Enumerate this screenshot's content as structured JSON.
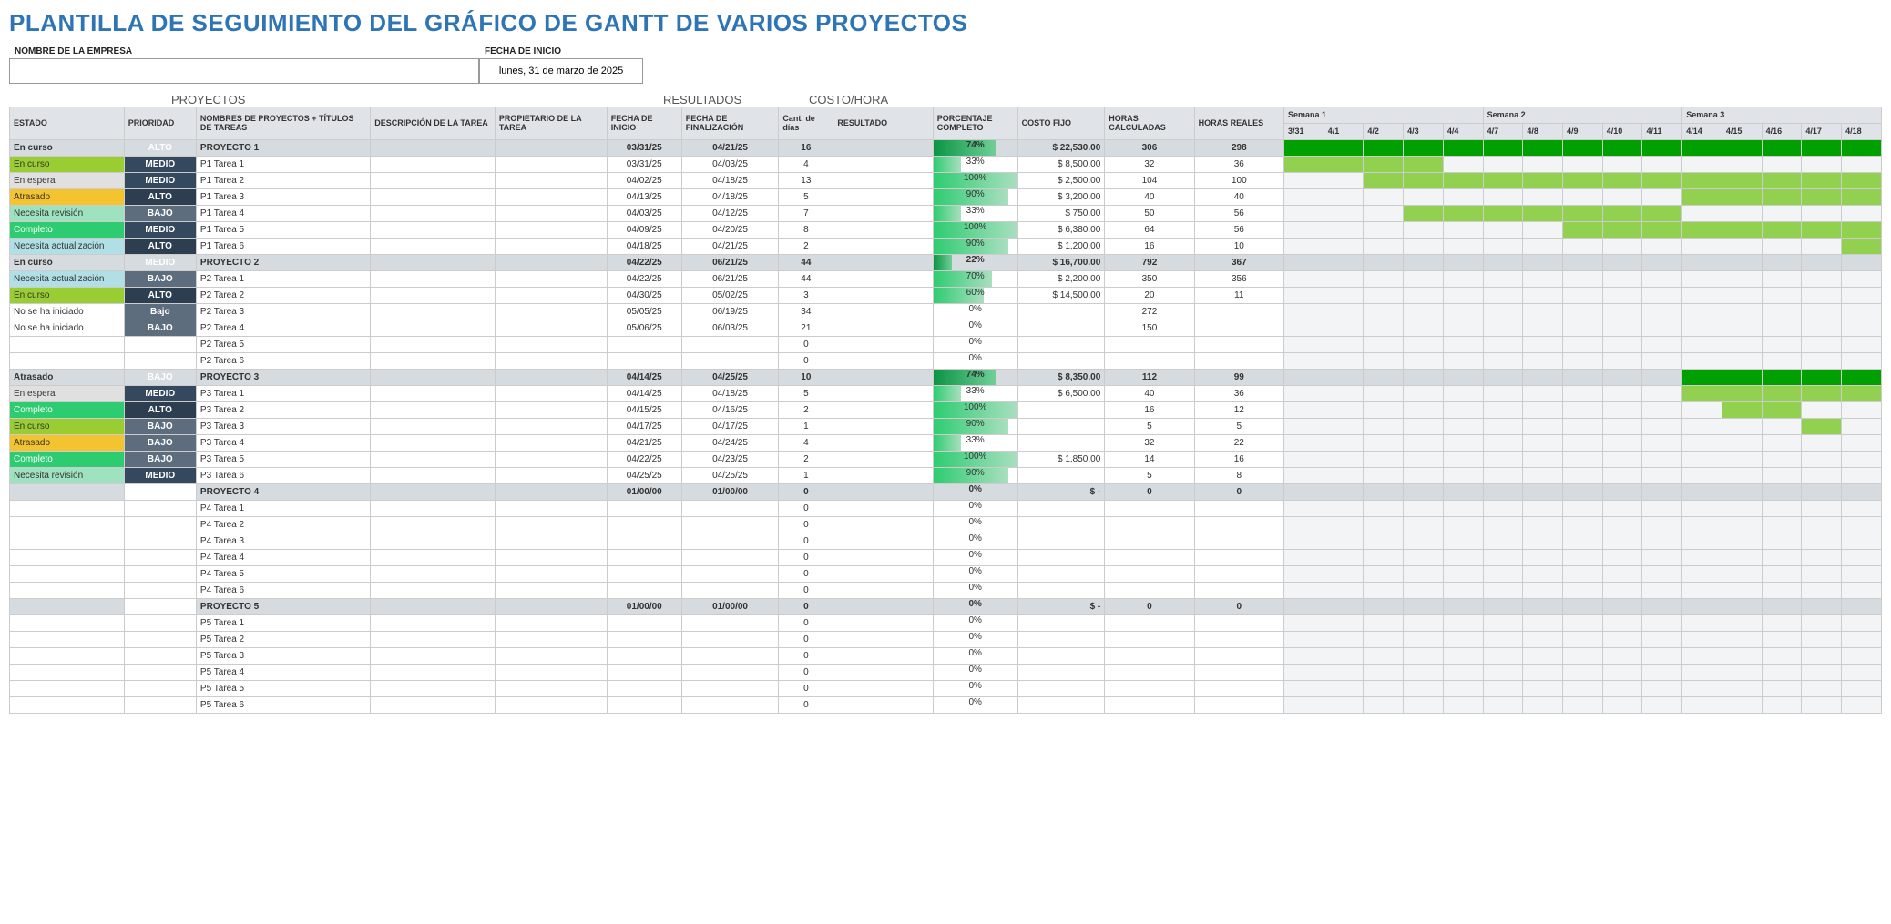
{
  "title": "PLANTILLA DE SEGUIMIENTO DEL GRÁFICO DE GANTT DE VARIOS PROYECTOS",
  "meta": {
    "company_label": "NOMBRE DE LA EMPRESA",
    "company_value": "",
    "date_label": "FECHA DE INICIO",
    "date_value": "lunes, 31 de marzo de 2025"
  },
  "sections": {
    "projects": "PROYECTOS",
    "results": "RESULTADOS",
    "cost": "COSTO/HORA"
  },
  "headers": {
    "estado": "ESTADO",
    "prioridad": "PRIORIDAD",
    "nombre": "NOMBRES DE PROYECTOS + TÍTULOS DE TAREAS",
    "descripcion": "DESCRIPCIÓN DE LA TAREA",
    "propietario": "PROPIETARIO DE LA TAREA",
    "inicio": "FECHA DE INICIO",
    "fin": "FECHA DE FINALIZACIÓN",
    "dias": "Cant. de días",
    "resultado": "RESULTADO",
    "pct": "PORCENTAJE COMPLETO",
    "costo": "COSTO FIJO",
    "hcalc": "HORAS CALCULADAS",
    "hreal": "HORAS REALES"
  },
  "weeks": [
    {
      "label": "Semana 1",
      "days": [
        "3/31",
        "4/1",
        "4/2",
        "4/3",
        "4/4"
      ]
    },
    {
      "label": "Semana 2",
      "days": [
        "4/7",
        "4/8",
        "4/9",
        "4/10",
        "4/11"
      ]
    },
    {
      "label": "Semana 3",
      "days": [
        "4/14",
        "4/15",
        "4/16",
        "4/17",
        "4/18"
      ]
    }
  ],
  "status_map": {
    "En curso": "st-encurso",
    "En espera": "st-enespera",
    "Atrasado": "st-atrasado",
    "Necesita revisión": "st-revision",
    "Completo": "st-completo",
    "Necesita actualización": "st-actualizacion",
    "No se ha iniciado": "st-noiniciado",
    "": ""
  },
  "prio_map": {
    "ALTO": "pr-alto",
    "MEDIO": "pr-medio",
    "BAJO": "pr-bajo",
    "Bajo": "pr-bajo",
    "": ""
  },
  "rows": [
    {
      "type": "project",
      "estado": "En curso",
      "prio": "ALTO",
      "nombre": "PROYECTO 1",
      "inicio": "03/31/25",
      "fin": "04/21/25",
      "dias": "16",
      "pct": 74,
      "costo": "$   22,530.00",
      "hcalc": "306",
      "hreal": "298",
      "bar": [
        0,
        15,
        "dark"
      ]
    },
    {
      "estado": "En curso",
      "prio": "MEDIO",
      "nombre": "P1 Tarea 1",
      "inicio": "03/31/25",
      "fin": "04/03/25",
      "dias": "4",
      "pct": 33,
      "costo": "$    8,500.00",
      "hcalc": "32",
      "hreal": "36",
      "bar": [
        0,
        4,
        "light"
      ]
    },
    {
      "estado": "En espera",
      "prio": "MEDIO",
      "nombre": "P1 Tarea 2",
      "inicio": "04/02/25",
      "fin": "04/18/25",
      "dias": "13",
      "pct": 100,
      "costo": "$    2,500.00",
      "hcalc": "104",
      "hreal": "100",
      "bar": [
        2,
        15,
        "light"
      ]
    },
    {
      "estado": "Atrasado",
      "prio": "ALTO",
      "nombre": "P1 Tarea 3",
      "inicio": "04/13/25",
      "fin": "04/18/25",
      "dias": "5",
      "pct": 90,
      "costo": "$    3,200.00",
      "hcalc": "40",
      "hreal": "40",
      "bar": [
        10,
        15,
        "light"
      ]
    },
    {
      "estado": "Necesita revisión",
      "prio": "BAJO",
      "nombre": "P1 Tarea 4",
      "inicio": "04/03/25",
      "fin": "04/12/25",
      "dias": "7",
      "pct": 33,
      "costo": "$      750.00",
      "hcalc": "50",
      "hreal": "56",
      "bar": [
        3,
        10,
        "light"
      ]
    },
    {
      "estado": "Completo",
      "prio": "MEDIO",
      "nombre": "P1 Tarea 5",
      "inicio": "04/09/25",
      "fin": "04/20/25",
      "dias": "8",
      "pct": 100,
      "costo": "$    6,380.00",
      "hcalc": "64",
      "hreal": "56",
      "bar": [
        7,
        15,
        "light"
      ]
    },
    {
      "estado": "Necesita actualización",
      "prio": "ALTO",
      "nombre": "P1 Tarea 6",
      "inicio": "04/18/25",
      "fin": "04/21/25",
      "dias": "2",
      "pct": 90,
      "costo": "$    1,200.00",
      "hcalc": "16",
      "hreal": "10",
      "bar": [
        14,
        15,
        "light"
      ]
    },
    {
      "type": "project",
      "estado": "En curso",
      "prio": "MEDIO",
      "nombre": "PROYECTO 2",
      "inicio": "04/22/25",
      "fin": "06/21/25",
      "dias": "44",
      "pct": 22,
      "costo": "$   16,700.00",
      "hcalc": "792",
      "hreal": "367"
    },
    {
      "estado": "Necesita actualización",
      "prio": "BAJO",
      "nombre": "P2 Tarea 1",
      "inicio": "04/22/25",
      "fin": "06/21/25",
      "dias": "44",
      "pct": 70,
      "costo": "$    2,200.00",
      "hcalc": "350",
      "hreal": "356"
    },
    {
      "estado": "En curso",
      "prio": "ALTO",
      "nombre": "P2 Tarea 2",
      "inicio": "04/30/25",
      "fin": "05/02/25",
      "dias": "3",
      "pct": 60,
      "costo": "$   14,500.00",
      "hcalc": "20",
      "hreal": "11"
    },
    {
      "estado": "No se ha iniciado",
      "prio": "Bajo",
      "nombre": "P2 Tarea 3",
      "inicio": "05/05/25",
      "fin": "06/19/25",
      "dias": "34",
      "pct": 0,
      "costo": "",
      "hcalc": "272",
      "hreal": ""
    },
    {
      "estado": "No se ha iniciado",
      "prio": "BAJO",
      "nombre": "P2 Tarea 4",
      "inicio": "05/06/25",
      "fin": "06/03/25",
      "dias": "21",
      "pct": 0,
      "costo": "",
      "hcalc": "150",
      "hreal": ""
    },
    {
      "estado": "",
      "prio": "",
      "nombre": "P2 Tarea 5",
      "inicio": "",
      "fin": "",
      "dias": "0",
      "pct": 0,
      "costo": "",
      "hcalc": "",
      "hreal": ""
    },
    {
      "estado": "",
      "prio": "",
      "nombre": "P2 Tarea 6",
      "inicio": "",
      "fin": "",
      "dias": "0",
      "pct": 0,
      "costo": "",
      "hcalc": "",
      "hreal": ""
    },
    {
      "type": "project",
      "estado": "Atrasado",
      "prio": "BAJO",
      "nombre": "PROYECTO 3",
      "inicio": "04/14/25",
      "fin": "04/25/25",
      "dias": "10",
      "pct": 74,
      "costo": "$    8,350.00",
      "hcalc": "112",
      "hreal": "99",
      "bar": [
        10,
        15,
        "dark"
      ]
    },
    {
      "estado": "En espera",
      "prio": "MEDIO",
      "nombre": "P3 Tarea 1",
      "inicio": "04/14/25",
      "fin": "04/18/25",
      "dias": "5",
      "pct": 33,
      "costo": "$    6,500.00",
      "hcalc": "40",
      "hreal": "36",
      "bar": [
        10,
        15,
        "light"
      ]
    },
    {
      "estado": "Completo",
      "prio": "ALTO",
      "nombre": "P3 Tarea 2",
      "inicio": "04/15/25",
      "fin": "04/16/25",
      "dias": "2",
      "pct": 100,
      "costo": "",
      "hcalc": "16",
      "hreal": "12",
      "bar": [
        11,
        13,
        "light"
      ]
    },
    {
      "estado": "En curso",
      "prio": "BAJO",
      "nombre": "P3 Tarea 3",
      "inicio": "04/17/25",
      "fin": "04/17/25",
      "dias": "1",
      "pct": 90,
      "costo": "",
      "hcalc": "5",
      "hreal": "5",
      "bar": [
        13,
        14,
        "light"
      ]
    },
    {
      "estado": "Atrasado",
      "prio": "BAJO",
      "nombre": "P3 Tarea 4",
      "inicio": "04/21/25",
      "fin": "04/24/25",
      "dias": "4",
      "pct": 33,
      "costo": "",
      "hcalc": "32",
      "hreal": "22"
    },
    {
      "estado": "Completo",
      "prio": "BAJO",
      "nombre": "P3 Tarea 5",
      "inicio": "04/22/25",
      "fin": "04/23/25",
      "dias": "2",
      "pct": 100,
      "costo": "$    1,850.00",
      "hcalc": "14",
      "hreal": "16"
    },
    {
      "estado": "Necesita revisión",
      "prio": "MEDIO",
      "nombre": "P3 Tarea 6",
      "inicio": "04/25/25",
      "fin": "04/25/25",
      "dias": "1",
      "pct": 90,
      "costo": "",
      "hcalc": "5",
      "hreal": "8"
    },
    {
      "type": "project",
      "estado": "",
      "prio": "",
      "nombre": "PROYECTO 4",
      "inicio": "01/00/00",
      "fin": "01/00/00",
      "dias": "0",
      "pct": 0,
      "costo": "$        -",
      "hcalc": "0",
      "hreal": "0"
    },
    {
      "estado": "",
      "prio": "",
      "nombre": "P4 Tarea 1",
      "inicio": "",
      "fin": "",
      "dias": "0",
      "pct": 0,
      "costo": "",
      "hcalc": "",
      "hreal": ""
    },
    {
      "estado": "",
      "prio": "",
      "nombre": "P4 Tarea 2",
      "inicio": "",
      "fin": "",
      "dias": "0",
      "pct": 0,
      "costo": "",
      "hcalc": "",
      "hreal": ""
    },
    {
      "estado": "",
      "prio": "",
      "nombre": "P4 Tarea 3",
      "inicio": "",
      "fin": "",
      "dias": "0",
      "pct": 0,
      "costo": "",
      "hcalc": "",
      "hreal": ""
    },
    {
      "estado": "",
      "prio": "",
      "nombre": "P4 Tarea 4",
      "inicio": "",
      "fin": "",
      "dias": "0",
      "pct": 0,
      "costo": "",
      "hcalc": "",
      "hreal": ""
    },
    {
      "estado": "",
      "prio": "",
      "nombre": "P4 Tarea 5",
      "inicio": "",
      "fin": "",
      "dias": "0",
      "pct": 0,
      "costo": "",
      "hcalc": "",
      "hreal": ""
    },
    {
      "estado": "",
      "prio": "",
      "nombre": "P4 Tarea 6",
      "inicio": "",
      "fin": "",
      "dias": "0",
      "pct": 0,
      "costo": "",
      "hcalc": "",
      "hreal": ""
    },
    {
      "type": "project",
      "estado": "",
      "prio": "",
      "nombre": "PROYECTO 5",
      "inicio": "01/00/00",
      "fin": "01/00/00",
      "dias": "0",
      "pct": 0,
      "costo": "$        -",
      "hcalc": "0",
      "hreal": "0"
    },
    {
      "estado": "",
      "prio": "",
      "nombre": "P5 Tarea 1",
      "inicio": "",
      "fin": "",
      "dias": "0",
      "pct": 0,
      "costo": "",
      "hcalc": "",
      "hreal": ""
    },
    {
      "estado": "",
      "prio": "",
      "nombre": "P5 Tarea 2",
      "inicio": "",
      "fin": "",
      "dias": "0",
      "pct": 0,
      "costo": "",
      "hcalc": "",
      "hreal": ""
    },
    {
      "estado": "",
      "prio": "",
      "nombre": "P5 Tarea 3",
      "inicio": "",
      "fin": "",
      "dias": "0",
      "pct": 0,
      "costo": "",
      "hcalc": "",
      "hreal": ""
    },
    {
      "estado": "",
      "prio": "",
      "nombre": "P5 Tarea 4",
      "inicio": "",
      "fin": "",
      "dias": "0",
      "pct": 0,
      "costo": "",
      "hcalc": "",
      "hreal": ""
    },
    {
      "estado": "",
      "prio": "",
      "nombre": "P5 Tarea 5",
      "inicio": "",
      "fin": "",
      "dias": "0",
      "pct": 0,
      "costo": "",
      "hcalc": "",
      "hreal": ""
    },
    {
      "estado": "",
      "prio": "",
      "nombre": "P5 Tarea 6",
      "inicio": "",
      "fin": "",
      "dias": "0",
      "pct": 0,
      "costo": "",
      "hcalc": "",
      "hreal": ""
    }
  ]
}
